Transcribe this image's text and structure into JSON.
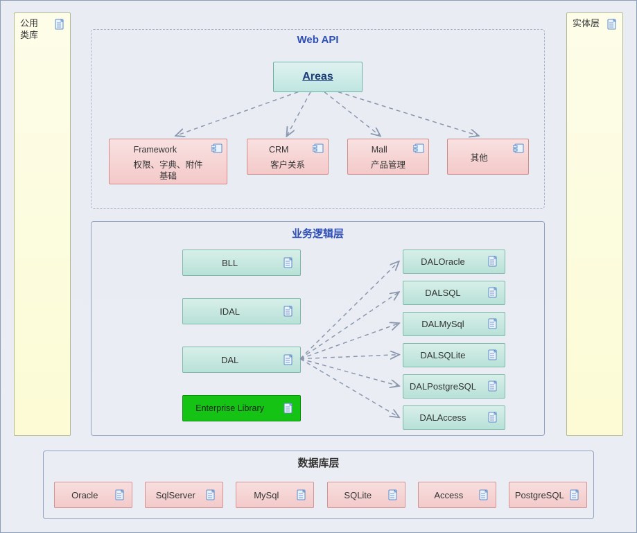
{
  "leftCol": {
    "label": "公用\n类库"
  },
  "rightCol": {
    "label": "实体层"
  },
  "webapi": {
    "title": "Web API",
    "areas": "Areas",
    "comps": [
      {
        "t1": "Framework",
        "t2": "权限、字典、附件",
        "t3": "基础"
      },
      {
        "t1": "CRM",
        "t2": "客户关系"
      },
      {
        "t1": "Mall",
        "t2": "产品管理"
      },
      {
        "t1": "其他"
      }
    ]
  },
  "bll": {
    "title": "业务逻辑层",
    "left": [
      "BLL",
      "IDAL",
      "DAL",
      "Enterprise Library"
    ],
    "right": [
      "DALOracle",
      "DALSQL",
      "DALMySql",
      "DALSQLite",
      "DALPostgreSQL",
      "DALAccess"
    ]
  },
  "db": {
    "title": "数据库层",
    "items": [
      "Oracle",
      "SqlServer",
      "MySql",
      "SQLite",
      "Access",
      "PostgreSQL"
    ]
  }
}
